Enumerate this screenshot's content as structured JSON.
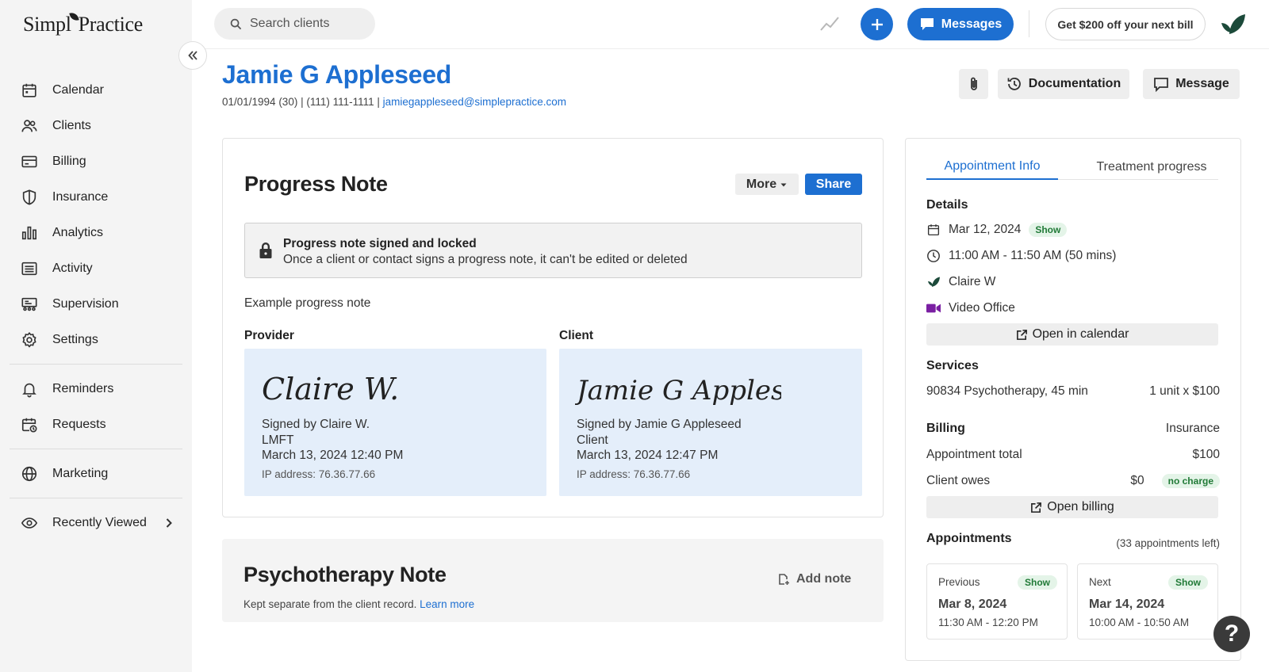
{
  "brand": {
    "logo_text_a": "Simpl",
    "logo_text_b": "Practice"
  },
  "sidebar": {
    "items": [
      {
        "label": "Calendar"
      },
      {
        "label": "Clients"
      },
      {
        "label": "Billing"
      },
      {
        "label": "Insurance"
      },
      {
        "label": "Analytics"
      },
      {
        "label": "Activity"
      },
      {
        "label": "Supervision"
      },
      {
        "label": "Settings"
      }
    ],
    "secondary": [
      {
        "label": "Reminders"
      },
      {
        "label": "Requests"
      }
    ],
    "marketing": {
      "label": "Marketing"
    },
    "recent": {
      "label": "Recently Viewed"
    }
  },
  "topbar": {
    "search_placeholder": "Search clients",
    "messages_label": "Messages",
    "promo_label": "Get $200 off your next bill",
    "accent": "#1d6fd1"
  },
  "client": {
    "name": "Jamie G Appleseed",
    "meta": "01/01/1994 (30) | (111) 111-1111 | ",
    "email": "jamiegappleseed@simplepractice.com",
    "documentation_label": "Documentation",
    "message_label": "Message"
  },
  "progress_note": {
    "title": "Progress Note",
    "more_label": "More",
    "share_label": "Share",
    "lock_title": "Progress note signed and locked",
    "lock_desc": "Once a client or contact signs a progress note, it can't be edited or deleted",
    "example": "Example progress note",
    "provider": {
      "heading": "Provider",
      "signature": "Claire W.",
      "signed_by": "Signed by Claire W.",
      "role": "LMFT",
      "datetime": "March 13, 2024 12:40 PM",
      "ip": "IP address: 76.36.77.66"
    },
    "client": {
      "heading": "Client",
      "signature": "Jamie G Appleseed",
      "signed_by": "Signed by Jamie G Appleseed",
      "role": "Client",
      "datetime": "March 13, 2024 12:47 PM",
      "ip": "IP address: 76.36.77.66"
    }
  },
  "psychotherapy_note": {
    "title": "Psychotherapy Note",
    "desc": "Kept separate from the client record. ",
    "learn_more": "Learn more",
    "add_note": "Add note"
  },
  "panel": {
    "tabs": [
      {
        "label": "Appointment Info",
        "active": true
      },
      {
        "label": "Treatment progress",
        "active": false
      }
    ],
    "details": {
      "heading": "Details",
      "date": "Mar 12, 2024",
      "status": "Show",
      "time": "11:00 AM - 11:50 AM (50 mins)",
      "clinician": "Claire W",
      "location": "Video Office",
      "open_calendar": "Open in calendar"
    },
    "services": {
      "heading": "Services",
      "code": "90834 Psychotherapy, 45 min",
      "units": "1 unit x $100"
    },
    "billing": {
      "heading": "Billing",
      "type": "Insurance",
      "total_label": "Appointment total",
      "total_value": "$100",
      "owes_label": "Client owes",
      "owes_value": "$0",
      "owes_badge": "no charge",
      "open_billing": "Open billing"
    },
    "appointments": {
      "heading": "Appointments",
      "left": "(33 appointments left)",
      "previous": {
        "label": "Previous",
        "status": "Show",
        "date": "Mar 8, 2024",
        "time": "11:30 AM - 12:20 PM"
      },
      "next": {
        "label": "Next",
        "status": "Show",
        "date": "Mar 14, 2024",
        "time": "10:00 AM - 10:50 AM"
      }
    }
  },
  "help": {
    "label": "?"
  }
}
